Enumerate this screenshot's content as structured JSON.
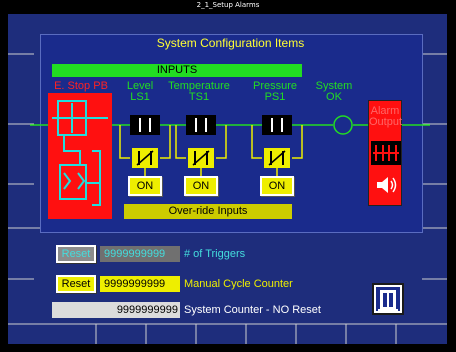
{
  "window": {
    "title": "2_1_Setup Alarms"
  },
  "panel": {
    "title": "System Configuration Items",
    "inputs_label": "INPUTS",
    "estop_label": "E. Stop PB",
    "level": {
      "label": "Level",
      "tag": "LS1"
    },
    "temperature": {
      "label": "Temperature",
      "tag": "TS1"
    },
    "pressure": {
      "label": "Pressure",
      "tag": "PS1"
    },
    "system_ok": {
      "line1": "System",
      "line2": "OK"
    },
    "alarm_output": {
      "line1": "Alarm",
      "line2": "Output"
    },
    "on_buttons": [
      "ON",
      "ON",
      "ON"
    ],
    "override_label": "Over-ride Inputs"
  },
  "counters": {
    "triggers": {
      "reset_label": "Reset",
      "value": "9999999999",
      "label": "# of Triggers"
    },
    "manual_cycle": {
      "reset_label": "Reset",
      "value": "9999999999",
      "label": "Manual Cycle Counter"
    },
    "system": {
      "value": "9999999999",
      "label": "System Counter - NO Reset"
    }
  },
  "colors": {
    "background": "#1e2d7c",
    "inputs_bar": "#22dd22",
    "alarm_red": "#ff1010",
    "button_yellow": "#eeee00",
    "counter_cyan": "#44dddd"
  },
  "icons": {
    "estop": "estop-circuit-icon",
    "alarm_relay": "relay-contact-icon",
    "alarm_horn": "speaker-horn-icon",
    "nav": "door-exit-icon"
  }
}
